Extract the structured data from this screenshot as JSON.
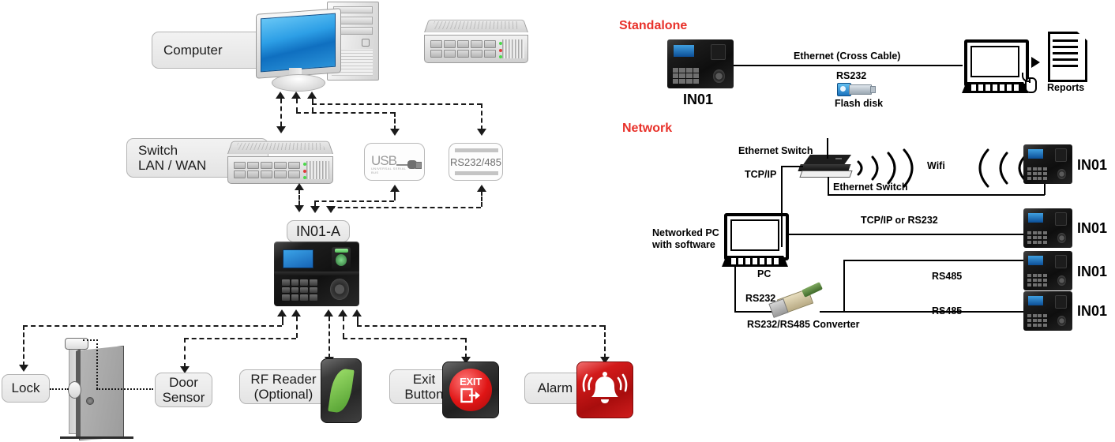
{
  "left_diagram": {
    "plates": [
      {
        "id": "computer",
        "label": "Computer"
      },
      {
        "id": "switch",
        "label": "Switch\nLAN / WAN"
      },
      {
        "id": "in01a",
        "label": "IN01-A"
      },
      {
        "id": "lock",
        "label": "Lock"
      },
      {
        "id": "door_sensor",
        "label": "Door\nSensor"
      },
      {
        "id": "rf_reader",
        "label": "RF Reader\n(Optional)"
      },
      {
        "id": "exit_button",
        "label": "Exit\nButton"
      },
      {
        "id": "alarm",
        "label": "Alarm"
      }
    ],
    "port_boxes": [
      {
        "id": "usb",
        "label": "USB",
        "sublabel": "UNIVERSAL SERIAL BUS"
      },
      {
        "id": "rs232485",
        "label": "RS232/485",
        "sublabel": ""
      }
    ],
    "exit_button_glyph": "EXIT"
  },
  "right_diagram": {
    "standalone": {
      "title": "Standalone",
      "device_label": "IN01",
      "link_labels": [
        "Ethernet  (Cross Cable)",
        "RS232"
      ],
      "flash_disk_label": "Flash disk",
      "reports_label": "Reports"
    },
    "network": {
      "title": "Network",
      "labels": {
        "ethernet_switch_top": "Ethernet Switch",
        "ethernet_switch_bottom": "Ethernet Switch",
        "tcpip": "TCP/IP",
        "wifi": "Wifi",
        "networked_pc": "Networked PC\nwith software",
        "pc": "PC",
        "tcpip_or_rs232": "TCP/IP or RS232",
        "rs232": "RS232",
        "converter": "RS232/RS485 Converter",
        "rs485_a": "RS485",
        "rs485_b": "RS485"
      },
      "devices": [
        {
          "label": "IN01"
        },
        {
          "label": "IN01"
        },
        {
          "label": "IN01"
        },
        {
          "label": "IN01"
        }
      ]
    }
  },
  "colors": {
    "section_title": "#e8312a",
    "line": "#1a1a1a",
    "alarm_red": "#d21a1a",
    "screen_blue": "#1663b5",
    "rf_green": "#5cb85c"
  }
}
